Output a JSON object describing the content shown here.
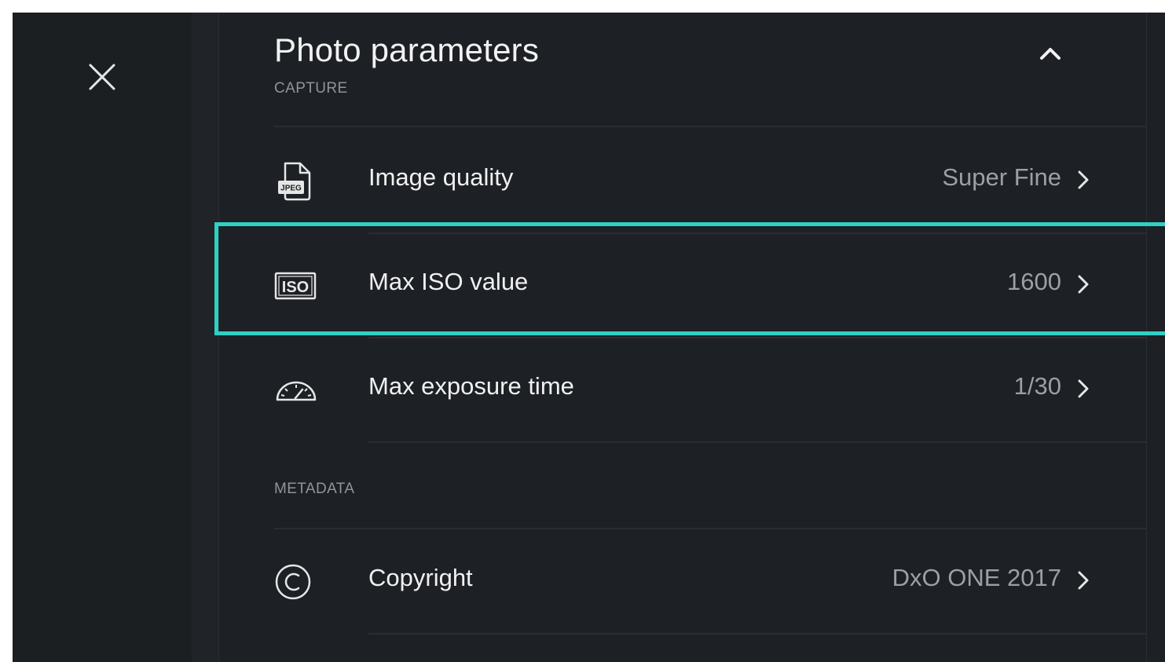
{
  "panel": {
    "title": "Photo parameters"
  },
  "sections": {
    "capture": {
      "label": "CAPTURE",
      "rows": [
        {
          "label": "Image quality",
          "value": "Super Fine",
          "icon": "jpeg-file-icon"
        },
        {
          "label": "Max ISO value",
          "value": "1600",
          "icon": "iso-icon"
        },
        {
          "label": "Max exposure time",
          "value": "1/30",
          "icon": "speedometer-icon"
        }
      ]
    },
    "metadata": {
      "label": "METADATA",
      "rows": [
        {
          "label": "Copyright",
          "value": "DxO ONE 2017",
          "icon": "copyright-icon"
        }
      ]
    }
  },
  "icons": {
    "close": "close-icon",
    "collapse": "chevron-up-icon",
    "row_chevron": "chevron-right-icon",
    "jpeg_text": "JPEG",
    "iso_text": "ISO"
  },
  "colors": {
    "background": "#1d2024",
    "highlight": "#2ed1c4",
    "text_primary": "#f0f0f0",
    "text_secondary": "#9aa0a6"
  }
}
